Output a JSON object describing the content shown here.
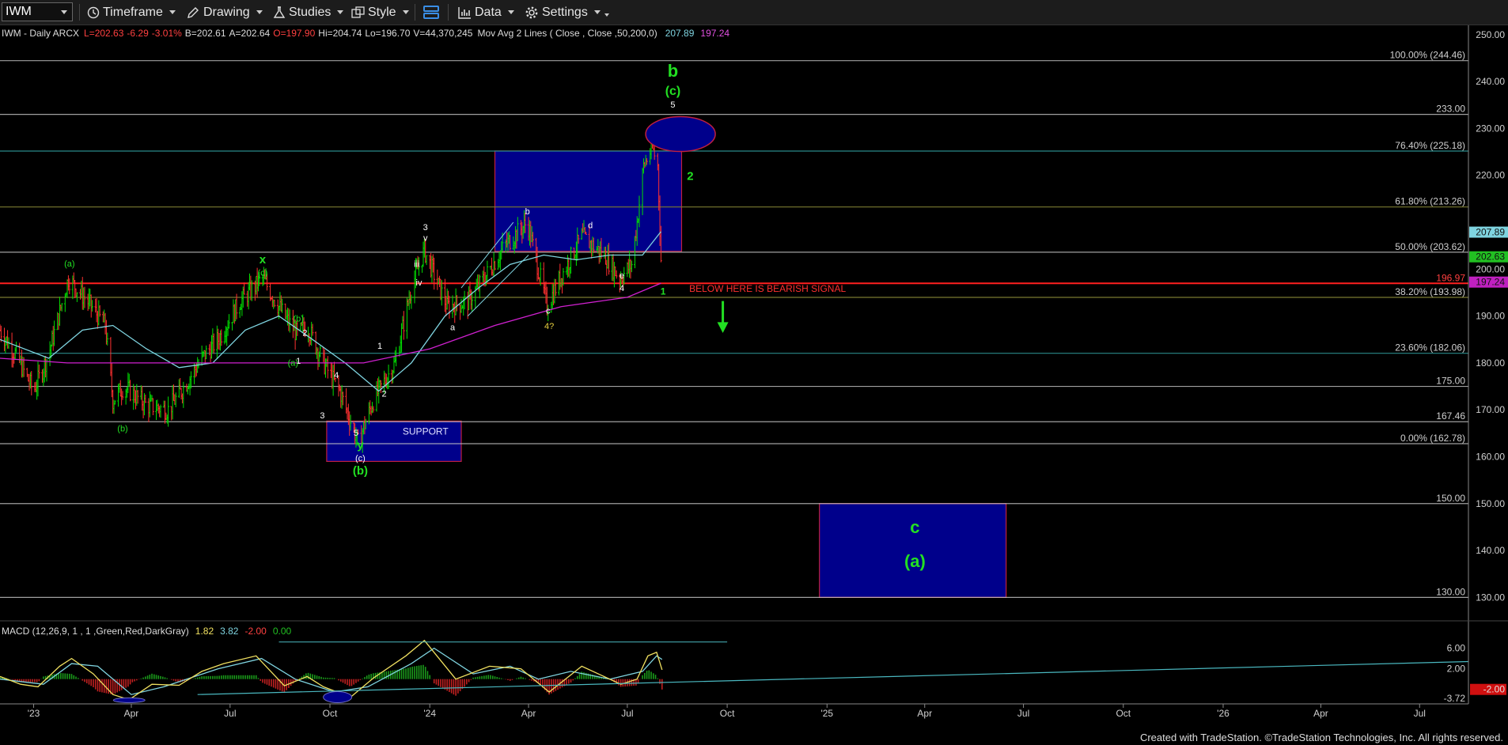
{
  "toolbar": {
    "symbol": "IWM",
    "timeframe": "Timeframe",
    "drawing": "Drawing",
    "studies": "Studies",
    "style": "Style",
    "data": "Data",
    "settings": "Settings"
  },
  "header": {
    "title": "IWM - Daily  ARCX",
    "last": "L=202.63",
    "change": "-6.29",
    "pct": "-3.01%",
    "bid": "B=202.61",
    "ask": "A=202.64",
    "open": "O=197.90",
    "high": "Hi=204.74",
    "low": "Lo=196.70",
    "volume": "V=44,370,245",
    "ma_label": "Mov Avg 2 Lines ( Close , Close ,50,200,0)",
    "ma50": "207.89",
    "ma200": "197.24"
  },
  "colors": {
    "up": "#00e000",
    "down": "#ff3030",
    "ma50": "#7fd4e0",
    "ma200": "#d020d0",
    "box_fill": "#00008b",
    "box_stroke": "#c02040",
    "wave_green": "#22e022",
    "level_line": "#c8c8c8",
    "fib_line": "#2a8a8a",
    "red_line": "#ff2020"
  },
  "chart_data": {
    "type": "line",
    "title": "IWM - Daily  ARCX",
    "y_axis": {
      "min": 125,
      "max": 252,
      "ticks": [
        130,
        140,
        150,
        160,
        170,
        180,
        190,
        200,
        210,
        220,
        230,
        240,
        250
      ]
    },
    "x_axis": {
      "labels": [
        "'23",
        "Apr",
        "Jul",
        "Oct",
        "'24",
        "Apr",
        "Jul",
        "Oct",
        "'25",
        "Apr",
        "Jul",
        "Oct",
        "'26",
        "Apr",
        "Jul"
      ],
      "start": "2022-12-01",
      "end": "2026-08-15"
    },
    "close_path": [
      [
        "2022-12-01",
        187
      ],
      [
        "2022-12-15",
        182
      ],
      [
        "2023-01-01",
        174
      ],
      [
        "2023-01-15",
        182
      ],
      [
        "2023-02-02",
        198
      ],
      [
        "2023-02-20",
        193
      ],
      [
        "2023-03-08",
        188
      ],
      [
        "2023-03-15",
        172
      ],
      [
        "2023-03-25",
        175
      ],
      [
        "2023-04-15",
        171
      ],
      [
        "2023-05-05",
        170
      ],
      [
        "2023-05-20",
        175
      ],
      [
        "2023-06-05",
        181
      ],
      [
        "2023-06-20",
        185
      ],
      [
        "2023-07-10",
        193
      ],
      [
        "2023-07-31",
        198
      ],
      [
        "2023-08-20",
        190
      ],
      [
        "2023-09-01",
        186
      ],
      [
        "2023-09-10",
        188
      ],
      [
        "2023-09-25",
        180
      ],
      [
        "2023-10-10",
        174
      ],
      [
        "2023-10-27",
        163
      ],
      [
        "2023-11-10",
        172
      ],
      [
        "2023-11-30",
        180
      ],
      [
        "2023-12-15",
        196
      ],
      [
        "2023-12-27",
        204
      ],
      [
        "2024-01-17",
        192
      ],
      [
        "2024-02-05",
        193
      ],
      [
        "2024-02-20",
        198
      ],
      [
        "2024-03-10",
        205
      ],
      [
        "2024-03-31",
        210
      ],
      [
        "2024-04-18",
        192
      ],
      [
        "2024-04-30",
        198
      ],
      [
        "2024-05-20",
        207
      ],
      [
        "2024-06-10",
        203
      ],
      [
        "2024-06-24",
        198
      ],
      [
        "2024-07-05",
        201
      ],
      [
        "2024-07-10",
        210
      ],
      [
        "2024-07-16",
        222
      ],
      [
        "2024-07-24",
        226
      ],
      [
        "2024-07-29",
        222
      ],
      [
        "2024-08-01",
        202
      ]
    ],
    "ma50_path": [
      [
        "2022-12-01",
        185
      ],
      [
        "2023-01-15",
        181
      ],
      [
        "2023-02-15",
        187
      ],
      [
        "2023-03-15",
        188
      ],
      [
        "2023-04-15",
        183
      ],
      [
        "2023-05-15",
        179
      ],
      [
        "2023-06-15",
        180
      ],
      [
        "2023-07-15",
        187
      ],
      [
        "2023-08-15",
        190
      ],
      [
        "2023-09-15",
        185
      ],
      [
        "2023-10-15",
        180
      ],
      [
        "2023-11-15",
        174
      ],
      [
        "2023-12-15",
        180
      ],
      [
        "2024-01-15",
        190
      ],
      [
        "2024-02-15",
        196
      ],
      [
        "2024-03-15",
        201
      ],
      [
        "2024-04-15",
        203
      ],
      [
        "2024-05-15",
        202
      ],
      [
        "2024-06-15",
        203
      ],
      [
        "2024-07-15",
        203
      ],
      [
        "2024-08-01",
        208
      ]
    ],
    "ma200_path": [
      [
        "2022-12-01",
        181
      ],
      [
        "2023-02-01",
        180
      ],
      [
        "2023-05-01",
        180
      ],
      [
        "2023-08-01",
        180
      ],
      [
        "2023-11-01",
        180
      ],
      [
        "2024-01-01",
        183
      ],
      [
        "2024-03-01",
        188
      ],
      [
        "2024-05-01",
        192
      ],
      [
        "2024-07-01",
        194
      ],
      [
        "2024-08-01",
        197
      ]
    ],
    "price_labels": [
      {
        "value": 250.0,
        "text": "250.00"
      },
      {
        "value": 240.0,
        "text": "240.00"
      },
      {
        "value": 230.0,
        "text": "230.00"
      },
      {
        "value": 220.0,
        "text": "220.00"
      },
      {
        "value": 207.89,
        "text": "207.89",
        "bg": "#7fd4e0"
      },
      {
        "value": 202.63,
        "text": "202.63",
        "bg": "#22c022"
      },
      {
        "value": 197.24,
        "text": "197.24",
        "bg": "#c020c0"
      },
      {
        "value": 200.0,
        "text": "200.00"
      },
      {
        "value": 190.0,
        "text": "190.00"
      },
      {
        "value": 180.0,
        "text": "180.00"
      },
      {
        "value": 170.0,
        "text": "170.00"
      },
      {
        "value": 160.0,
        "text": "160.00"
      },
      {
        "value": 150.0,
        "text": "150.00"
      },
      {
        "value": 140.0,
        "text": "140.00"
      },
      {
        "value": 130.0,
        "text": "130.00"
      }
    ],
    "levels": [
      {
        "value": 244.46,
        "label": "100.00% (244.46)",
        "style": "white"
      },
      {
        "value": 233.0,
        "label": "233.00",
        "style": "white"
      },
      {
        "value": 225.18,
        "label": "76.40% (225.18)",
        "style": "teal"
      },
      {
        "value": 213.26,
        "label": "61.80% (213.26)",
        "style": "olive"
      },
      {
        "value": 203.62,
        "label": "50.00% (203.62)",
        "style": "white"
      },
      {
        "value": 196.97,
        "label": "196.97",
        "style": "red"
      },
      {
        "value": 193.98,
        "label": "38.20% (193.98)",
        "style": "olive"
      },
      {
        "value": 182.06,
        "label": "23.60% (182.06)",
        "style": "teal"
      },
      {
        "value": 175.0,
        "label": "175.00",
        "style": "white"
      },
      {
        "value": 167.46,
        "label": "167.46",
        "style": "white"
      },
      {
        "value": 162.78,
        "label": "0.00% (162.78)",
        "style": "white"
      },
      {
        "value": 150.0,
        "label": "150.00",
        "style": "white"
      },
      {
        "value": 130.0,
        "label": "130.00",
        "style": "white"
      }
    ],
    "zones": [
      {
        "x0": "2024-03-01",
        "x1": "2024-08-20",
        "y0": 203.8,
        "y1": 225.2
      },
      {
        "x0": "2023-09-28",
        "x1": "2024-01-30",
        "y0": 159,
        "y1": 167.6,
        "label": "SUPPORT"
      },
      {
        "x0": "2024-12-25",
        "x1": "2025-06-15",
        "y0": 130,
        "y1": 150
      }
    ],
    "annotations": [
      {
        "text": "b",
        "date": "2024-08-12",
        "value": 241,
        "color": "green",
        "size": 22
      },
      {
        "text": "(c)",
        "date": "2024-08-12",
        "value": 237.2,
        "color": "green",
        "size": 16
      },
      {
        "text": "5",
        "date": "2024-08-12",
        "value": 234.5,
        "color": "white",
        "size": 11
      },
      {
        "text": "2",
        "date": "2024-08-28",
        "value": 219,
        "color": "green",
        "size": 15
      },
      {
        "text": "1",
        "date": "2024-08-03",
        "value": 194.6,
        "color": "green",
        "size": 12
      },
      {
        "text": "BELOW HERE IS BEARISH SIGNAL",
        "date": "2024-08-27",
        "value": 195.2,
        "color": "red",
        "size": 12
      },
      {
        "text": "3",
        "date": "2023-12-28",
        "value": 208.3,
        "color": "white",
        "size": 11
      },
      {
        "text": "v",
        "date": "2023-12-28",
        "value": 206,
        "color": "white",
        "size": 11
      },
      {
        "text": "iii",
        "date": "2023-12-20",
        "value": 200.5,
        "color": "white",
        "size": 11
      },
      {
        "text": "iv",
        "date": "2023-12-22",
        "value": 196.5,
        "color": "white",
        "size": 11
      },
      {
        "text": "a",
        "date": "2024-01-22",
        "value": 187,
        "color": "white",
        "size": 11
      },
      {
        "text": "b",
        "date": "2024-03-31",
        "value": 211.7,
        "color": "white",
        "size": 11
      },
      {
        "text": "c",
        "date": "2024-04-19",
        "value": 190.5,
        "color": "white",
        "size": 11
      },
      {
        "text": "4?",
        "date": "2024-04-20",
        "value": 187.2,
        "color": "yellow",
        "size": 11
      },
      {
        "text": "d",
        "date": "2024-05-28",
        "value": 208.7,
        "color": "white",
        "size": 11
      },
      {
        "text": "e",
        "date": "2024-06-26",
        "value": 198,
        "color": "white",
        "size": 11
      },
      {
        "text": "4",
        "date": "2024-06-26",
        "value": 195.3,
        "color": "white",
        "size": 11
      },
      {
        "text": "(a)",
        "date": "2023-02-03",
        "value": 200.6,
        "color": "green",
        "size": 11
      },
      {
        "text": "(b)",
        "date": "2023-03-24",
        "value": 165.4,
        "color": "green",
        "size": 11
      },
      {
        "text": "x",
        "date": "2023-07-31",
        "value": 201.2,
        "color": "green",
        "size": 15
      },
      {
        "text": "(c)",
        "date": "2023-07-31",
        "value": 198.6,
        "color": "green",
        "size": 11
      },
      {
        "text": "(b)",
        "date": "2023-09-02",
        "value": 188.8,
        "color": "green",
        "size": 11
      },
      {
        "text": "2",
        "date": "2023-09-08",
        "value": 185.8,
        "color": "white",
        "size": 11
      },
      {
        "text": "1",
        "date": "2023-09-02",
        "value": 179.8,
        "color": "white",
        "size": 11
      },
      {
        "text": "(a)",
        "date": "2023-08-28",
        "value": 179.4,
        "color": "green",
        "size": 11
      },
      {
        "text": "4",
        "date": "2023-10-07",
        "value": 176.8,
        "color": "white",
        "size": 11
      },
      {
        "text": "3",
        "date": "2023-09-24",
        "value": 168.2,
        "color": "white",
        "size": 11
      },
      {
        "text": "5",
        "date": "2023-10-25",
        "value": 164.5,
        "color": "white",
        "size": 11
      },
      {
        "text": "y",
        "date": "2023-10-29",
        "value": 161.7,
        "color": "green",
        "size": 15
      },
      {
        "text": "(c)",
        "date": "2023-10-29",
        "value": 159.1,
        "color": "white",
        "size": 11
      },
      {
        "text": "(b)",
        "date": "2023-10-29",
        "value": 156.2,
        "color": "green",
        "size": 15
      },
      {
        "text": "1",
        "date": "2023-11-16",
        "value": 183,
        "color": "white",
        "size": 11
      },
      {
        "text": "2",
        "date": "2023-11-20",
        "value": 172.8,
        "color": "white",
        "size": 11
      },
      {
        "text": "c",
        "date": "2025-03-23",
        "value": 143.7,
        "color": "green",
        "size": 22
      },
      {
        "text": "(a)",
        "date": "2025-03-23",
        "value": 136.5,
        "color": "green",
        "size": 22
      }
    ],
    "macd": {
      "label": "MACD (12,26,9, 1 , 1 ,Green,Red,DarkGray)",
      "macd_value": "1.82",
      "signal_value": "3.82",
      "hist_value": "-2.00",
      "zero_value": "0.00",
      "y_ticks": [
        "6.00",
        "2.00",
        "-3.72",
        "-2.00"
      ],
      "y_axis": {
        "min": -4.5,
        "max": 9
      },
      "line": [
        [
          "2022-12-01",
          0.5
        ],
        [
          "2022-12-20",
          -1
        ],
        [
          "2023-01-05",
          -1.5
        ],
        [
          "2023-01-25",
          2.5
        ],
        [
          "2023-02-05",
          4
        ],
        [
          "2023-02-25",
          1
        ],
        [
          "2023-03-15",
          -3
        ],
        [
          "2023-03-30",
          -4
        ],
        [
          "2023-04-20",
          -1
        ],
        [
          "2023-05-15",
          -1.2
        ],
        [
          "2023-06-05",
          1.5
        ],
        [
          "2023-06-25",
          3
        ],
        [
          "2023-07-25",
          4.5
        ],
        [
          "2023-08-20",
          -1.3
        ],
        [
          "2023-09-10",
          0.5
        ],
        [
          "2023-09-25",
          -1.5
        ],
        [
          "2023-10-20",
          -3.5
        ],
        [
          "2023-11-10",
          0.2
        ],
        [
          "2023-12-10",
          4.5
        ],
        [
          "2023-12-27",
          7.5
        ],
        [
          "2024-01-25",
          0
        ],
        [
          "2024-02-25",
          2.5
        ],
        [
          "2024-03-25",
          2
        ],
        [
          "2024-04-20",
          -2.5
        ],
        [
          "2024-05-20",
          2.5
        ],
        [
          "2024-06-25",
          -1
        ],
        [
          "2024-07-10",
          0
        ],
        [
          "2024-07-20",
          4.5
        ],
        [
          "2024-07-28",
          5.2
        ],
        [
          "2024-08-02",
          1.8
        ]
      ],
      "signal": [
        [
          "2022-12-01",
          0
        ],
        [
          "2023-01-10",
          -1
        ],
        [
          "2023-02-05",
          3
        ],
        [
          "2023-03-01",
          2.5
        ],
        [
          "2023-04-01",
          -3
        ],
        [
          "2023-05-01",
          -1.5
        ],
        [
          "2023-06-20",
          2
        ],
        [
          "2023-07-30",
          4
        ],
        [
          "2023-08-30",
          0
        ],
        [
          "2023-10-05",
          -2.5
        ],
        [
          "2023-11-05",
          -1.5
        ],
        [
          "2023-12-15",
          3
        ],
        [
          "2024-01-05",
          6
        ],
        [
          "2024-02-10",
          1
        ],
        [
          "2024-03-15",
          2.5
        ],
        [
          "2024-04-10",
          0
        ],
        [
          "2024-05-10",
          1.5
        ],
        [
          "2024-06-15",
          0
        ],
        [
          "2024-07-15",
          1.5
        ],
        [
          "2024-07-28",
          4.5
        ],
        [
          "2024-08-02",
          3.82
        ]
      ],
      "trend_top": [
        [
          "2023-08-15",
          7.2
        ],
        [
          "2024-10-01",
          7.2
        ]
      ],
      "trend_bottom": [
        [
          "2023-06-01",
          -3
        ],
        [
          "2026-08-15",
          3.4
        ]
      ]
    }
  },
  "footer": "Created with TradeStation. ©TradeStation Technologies, Inc. All rights reserved."
}
